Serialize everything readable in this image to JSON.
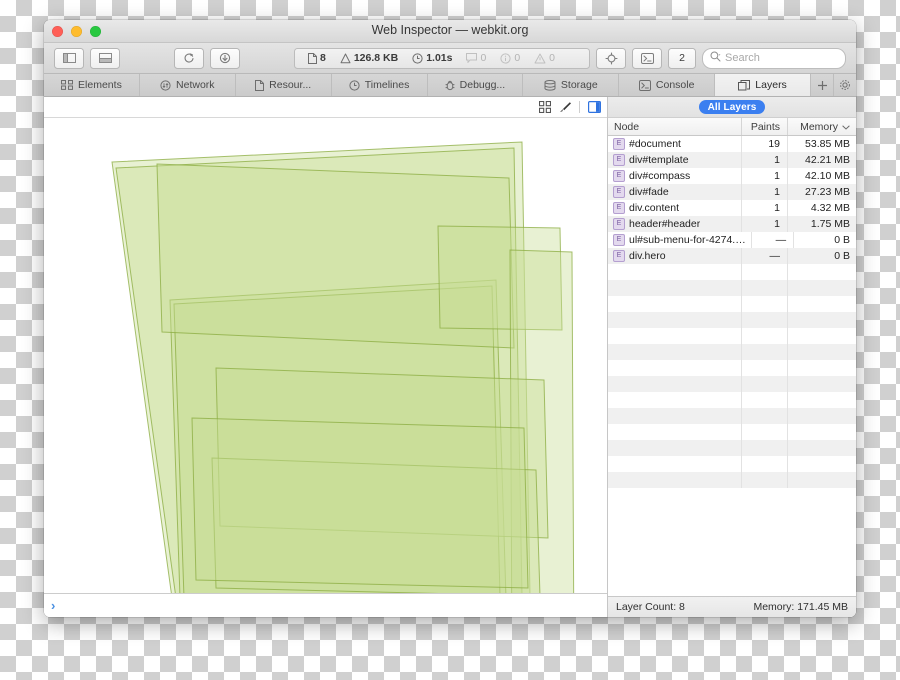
{
  "window": {
    "title": "Web Inspector — webkit.org",
    "traffic_lights": [
      "close",
      "minimize",
      "zoom"
    ]
  },
  "toolbar": {
    "layout_sidebar_button": "toggle-sidebar",
    "layout_split_button": "toggle-split",
    "reload_button": "reload",
    "download_button": "download",
    "stats": [
      {
        "icon": "document-icon",
        "value": "8",
        "dim": false
      },
      {
        "icon": "download-size-icon",
        "value": "126.8 KB",
        "dim": false
      },
      {
        "icon": "clock-icon",
        "value": "1.01s",
        "dim": false
      },
      {
        "icon": "message-icon",
        "value": "0",
        "dim": true
      },
      {
        "icon": "info-icon",
        "value": "0",
        "dim": true
      },
      {
        "icon": "warning-icon",
        "value": "0",
        "dim": true
      }
    ],
    "inspect_button": "inspect-element",
    "console_button": "toggle-console",
    "node_count": "2",
    "search": {
      "placeholder": "Search",
      "value": ""
    }
  },
  "tabs": [
    {
      "label": "Elements",
      "icon": "elements-icon",
      "active": false
    },
    {
      "label": "Network",
      "icon": "network-icon",
      "active": false
    },
    {
      "label": "Resour...",
      "icon": "resources-icon",
      "active": false
    },
    {
      "label": "Timelines",
      "icon": "timelines-icon",
      "active": false
    },
    {
      "label": "Debugg...",
      "icon": "debugger-icon",
      "active": false
    },
    {
      "label": "Storage",
      "icon": "storage-icon",
      "active": false
    },
    {
      "label": "Console",
      "icon": "console-icon",
      "active": false
    },
    {
      "label": "Layers",
      "icon": "layers-icon",
      "active": true
    }
  ],
  "tab_extras": [
    {
      "name": "add-tab-button",
      "glyph": "+"
    },
    {
      "name": "settings-gear-button",
      "glyph": "gear"
    }
  ],
  "canvas": {
    "toolbar": [
      {
        "name": "grid-icon",
        "active": false
      },
      {
        "name": "paintbrush-icon",
        "active": false
      },
      {
        "name": "sidebar-toggle-icon",
        "active": true
      }
    ],
    "accent_blue": "#3b7ff0",
    "layer_fill": "#c8dd96",
    "layer_stroke": "#8aab3f"
  },
  "console": {
    "prompt_glyph": "›",
    "prompt_color": "#4a90e2",
    "value": ""
  },
  "sidebar": {
    "filter_pill": "All Layers",
    "columns": [
      "Node",
      "Paints",
      "Memory"
    ],
    "sorted_column": "Memory",
    "rows": [
      {
        "badge": "E",
        "node": "#document",
        "paints": "19",
        "memory": "53.85 MB"
      },
      {
        "badge": "E",
        "node": "div#template",
        "paints": "1",
        "memory": "42.21 MB"
      },
      {
        "badge": "E",
        "node": "div#compass",
        "paints": "1",
        "memory": "42.10 MB"
      },
      {
        "badge": "E",
        "node": "div#fade",
        "paints": "1",
        "memory": "27.23 MB"
      },
      {
        "badge": "E",
        "node": "div.content",
        "paints": "1",
        "memory": "4.32 MB"
      },
      {
        "badge": "E",
        "node": "header#header",
        "paints": "1",
        "memory": "1.75 MB"
      },
      {
        "badge": "E",
        "node": "ul#sub-menu-for-4274.sub-…",
        "paints": "—",
        "memory": "0 B"
      },
      {
        "badge": "E",
        "node": "div.hero",
        "paints": "—",
        "memory": "0 B"
      }
    ],
    "status": {
      "layer_count": "Layer Count: 8",
      "memory_total": "Memory: 171.45 MB"
    }
  }
}
